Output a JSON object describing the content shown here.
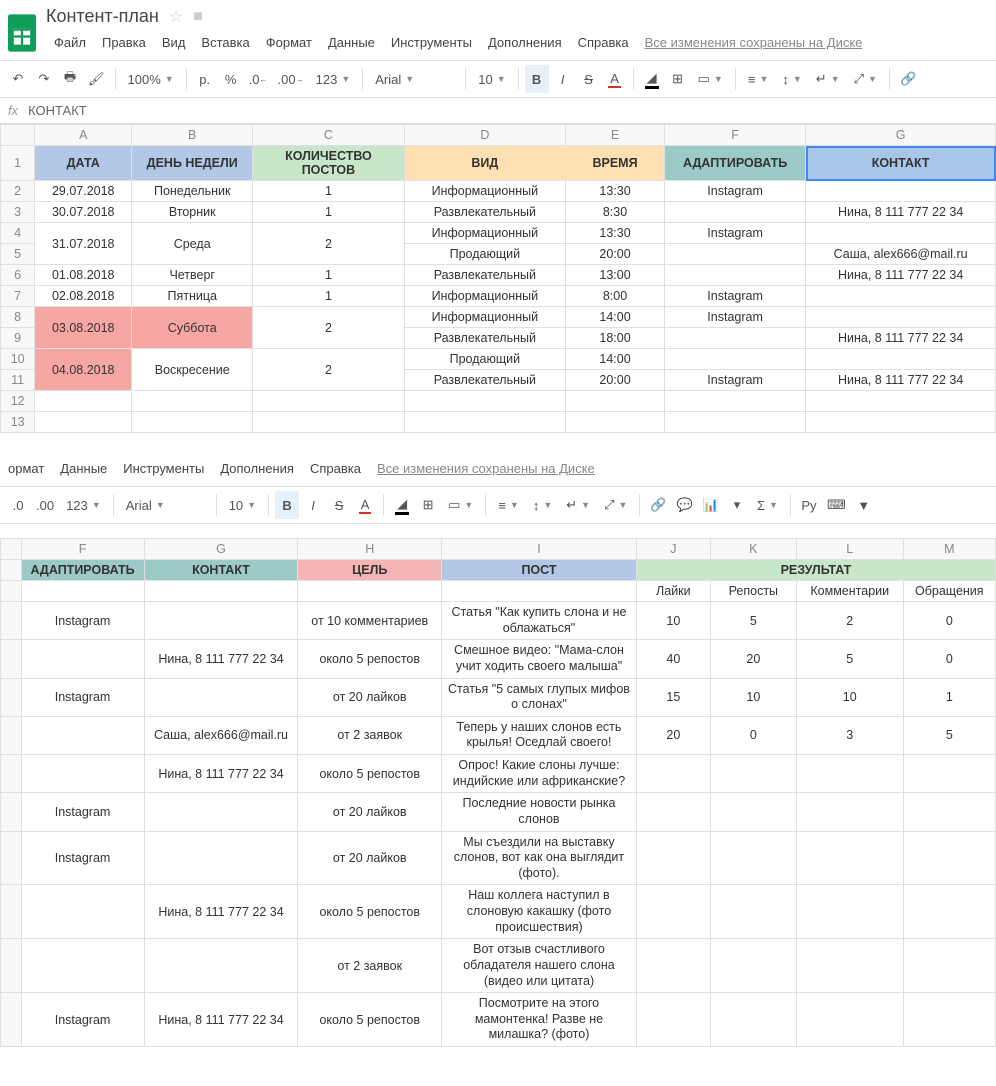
{
  "doc": {
    "title": "Контент-план"
  },
  "menu": {
    "file": "Файл",
    "edit": "Правка",
    "view": "Вид",
    "insert": "Вставка",
    "format": "Формат",
    "data": "Данные",
    "tools": "Инструменты",
    "addons": "Дополнения",
    "help": "Справка",
    "saved": "Все изменения сохранены на Диске"
  },
  "tb": {
    "zoom": "100%",
    "currency": "р.",
    "percent": "%",
    "dec_dec": ".0",
    "dec_inc": ".00",
    "numfmt": "123",
    "font": "Arial",
    "size": "10",
    "bold": "B",
    "italic": "I",
    "strike": "S",
    "ru": "Ру"
  },
  "fx": {
    "label": "fx",
    "value": "КОНТАКТ"
  },
  "t1": {
    "cols": [
      "",
      "A",
      "B",
      "C",
      "D",
      "E",
      "F",
      "G"
    ],
    "hdr": {
      "date": "ДАТА",
      "dow": "ДЕНЬ НЕДЕЛИ",
      "count": "КОЛИЧЕСТВО ПОСТОВ",
      "kind": "ВИД",
      "time": "ВРЕМЯ",
      "adapt": "АДАПТИРОВАТЬ",
      "contact": "КОНТАКТ"
    },
    "rows": [
      {
        "n": "2",
        "date": "29.07.2018",
        "dow": "Понедельник",
        "count": "1",
        "kind": "Информационный",
        "time": "13:30",
        "adapt": "Instagram",
        "contact": ""
      },
      {
        "n": "3",
        "date": "30.07.2018",
        "dow": "Вторник",
        "count": "1",
        "kind": "Развлекательный",
        "time": "8:30",
        "adapt": "",
        "contact": "Нина, 8 111 777 22 34"
      },
      {
        "n": "4",
        "date": "31.07.2018",
        "dow": "Среда",
        "count": "2",
        "kind": "Информационный",
        "time": "13:30",
        "adapt": "Instagram",
        "contact": "",
        "merge": true
      },
      {
        "n": "5",
        "kind": "Продающий",
        "time": "20:00",
        "adapt": "",
        "contact": "Саша, alex666@mail.ru"
      },
      {
        "n": "6",
        "date": "01.08.2018",
        "dow": "Четверг",
        "count": "1",
        "kind": "Развлекательный",
        "time": "13:00",
        "adapt": "",
        "contact": "Нина, 8 111 777 22 34"
      },
      {
        "n": "7",
        "date": "02.08.2018",
        "dow": "Пятница",
        "count": "1",
        "kind": "Информационный",
        "time": "8:00",
        "adapt": "Instagram",
        "contact": ""
      },
      {
        "n": "8",
        "date": "03.08.2018",
        "dow": "Суббота",
        "count": "2",
        "kind": "Информационный",
        "time": "14:00",
        "adapt": "Instagram",
        "contact": "",
        "merge": true,
        "weekend": true
      },
      {
        "n": "9",
        "kind": "Развлекательный",
        "time": "18:00",
        "adapt": "",
        "contact": "Нина, 8 111 777 22 34"
      },
      {
        "n": "10",
        "date": "04.08.2018",
        "dow": "Воскресение",
        "count": "2",
        "kind": "Продающий",
        "time": "14:00",
        "adapt": "",
        "contact": "",
        "merge": true,
        "weekend": true
      },
      {
        "n": "11",
        "kind": "Развлекательный",
        "time": "20:00",
        "adapt": "Instagram",
        "contact": "Нина, 8 111 777 22 34"
      }
    ],
    "empty": [
      "12",
      "13"
    ]
  },
  "menu2": {
    "format": "ормат",
    "data": "Данные",
    "tools": "Инструменты",
    "addons": "Дополнения",
    "help": "Справка",
    "saved": "Все изменения сохранены на Диске"
  },
  "t2": {
    "cols": [
      "",
      "F",
      "G",
      "H",
      "I",
      "J",
      "K",
      "L",
      "M"
    ],
    "hdr": {
      "adapt": "АДАПТИРОВАТЬ",
      "contact": "КОНТАКТ",
      "goal": "ЦЕЛЬ",
      "post": "ПОСТ",
      "result": "РЕЗУЛЬТАТ",
      "likes": "Лайки",
      "reposts": "Репосты",
      "comments": "Комментарии",
      "requests": "Обращения"
    },
    "rows": [
      {
        "adapt": "Instagram",
        "contact": "",
        "goal": "от 10 комментариев",
        "post": "Статья \"Как купить слона и не облажаться\"",
        "likes": "10",
        "reposts": "5",
        "comments": "2",
        "requests": "0"
      },
      {
        "adapt": "",
        "contact": "Нина, 8 111 777 22 34",
        "goal": "около 5 репостов",
        "post": "Смешное видео: \"Мама-слон учит ходить своего малыша\"",
        "likes": "40",
        "reposts": "20",
        "comments": "5",
        "requests": "0"
      },
      {
        "adapt": "Instagram",
        "contact": "",
        "goal": "от 20 лайков",
        "post": "Статья \"5 самых глупых мифов о слонах\"",
        "likes": "15",
        "reposts": "10",
        "comments": "10",
        "requests": "1"
      },
      {
        "adapt": "",
        "contact": "Саша, alex666@mail.ru",
        "goal": "от 2 заявок",
        "post": "Теперь у наших слонов есть крылья! Оседлай своего!",
        "likes": "20",
        "reposts": "0",
        "comments": "3",
        "requests": "5"
      },
      {
        "adapt": "",
        "contact": "Нина, 8 111 777 22 34",
        "goal": "около 5 репостов",
        "post": "Опрос! Какие слоны лучше: индийские или африканские?",
        "likes": "",
        "reposts": "",
        "comments": "",
        "requests": ""
      },
      {
        "adapt": "Instagram",
        "contact": "",
        "goal": "от 20 лайков",
        "post": "Последние новости рынка слонов",
        "likes": "",
        "reposts": "",
        "comments": "",
        "requests": ""
      },
      {
        "adapt": "Instagram",
        "contact": "",
        "goal": "от 20 лайков",
        "post": "Мы съездили на выставку слонов, вот как она выглядит (фото).",
        "likes": "",
        "reposts": "",
        "comments": "",
        "requests": ""
      },
      {
        "adapt": "",
        "contact": "Нина, 8 111 777 22 34",
        "goal": "около 5 репостов",
        "post": "Наш коллега наступил в слоновую какашку (фото происшествия)",
        "likes": "",
        "reposts": "",
        "comments": "",
        "requests": ""
      },
      {
        "adapt": "",
        "contact": "",
        "goal": "от 2 заявок",
        "post": "Вот отзыв счастливого обладателя нашего слона (видео или цитата)",
        "likes": "",
        "reposts": "",
        "comments": "",
        "requests": ""
      },
      {
        "adapt": "Instagram",
        "contact": "Нина, 8 111 777 22 34",
        "goal": "около 5 репостов",
        "post": "Посмотрите на этого мамонтенка! Разве не милашка? (фото)",
        "likes": "",
        "reposts": "",
        "comments": "",
        "requests": ""
      }
    ]
  }
}
